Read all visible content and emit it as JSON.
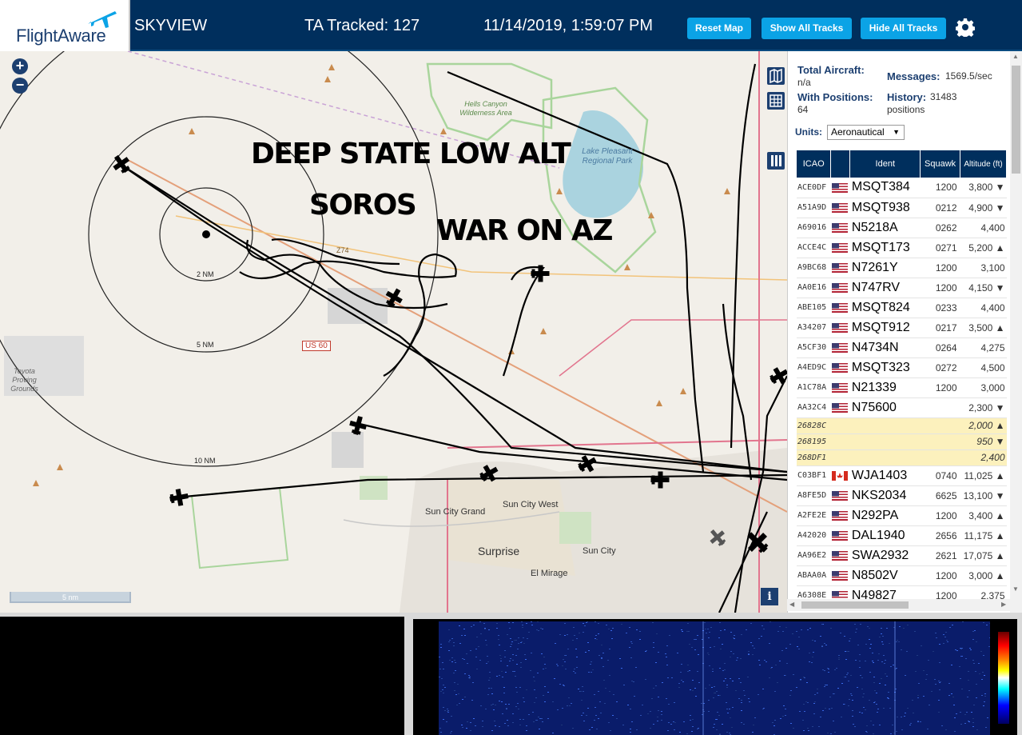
{
  "header": {
    "logo_text": "FlightAware",
    "app_name": "SKYVIEW",
    "tracked": "TA Tracked: 127",
    "datetime": "11/14/2019, 1:59:07 PM",
    "buttons": {
      "reset": "Reset Map",
      "show_all": "Show All Tracks",
      "hide_all": "Hide All Tracks"
    },
    "accent_color": "#0ba3e6",
    "bar_color": "#002f5d"
  },
  "map": {
    "zoom_in": "+",
    "zoom_out": "−",
    "overlay": [
      "DEEP STATE LOW ALT",
      "SOROS",
      "WAR ON AZ"
    ],
    "range_rings": [
      "2 NM",
      "5 NM",
      "10 NM"
    ],
    "places": [
      "Hells Canyon Wilderness Area",
      "Lake Pleasant Regional Park",
      "Toyota Proving Grounds",
      "Sun City Grand",
      "Sun City West",
      "Surprise",
      "Sun City",
      "El Mirage"
    ],
    "road_labels": [
      "US 60",
      "Z74"
    ],
    "scale": "5 nm",
    "info": "i"
  },
  "panel": {
    "total_aircraft_label": "Total Aircraft:",
    "total_aircraft_value": "n/a",
    "messages_label": "Messages:",
    "messages_value": "1569.5/sec",
    "with_positions_label": "With Positions:",
    "with_positions_value": "64",
    "history_label": "History:",
    "history_value": "31483",
    "history_unit": "positions",
    "units_label": "Units:",
    "units_value": "Aeronautical",
    "columns": {
      "icao": "ICAO",
      "ident": "Ident",
      "squawk": "Squawk",
      "altitude": "Altitude (ft)"
    },
    "rows": [
      {
        "icao": "ACE0DF",
        "flag": "US",
        "ident": "MSQT384",
        "squawk": "1200",
        "alt": "3,800 ▼"
      },
      {
        "icao": "A51A9D",
        "flag": "US",
        "ident": "MSQT938",
        "squawk": "0212",
        "alt": "4,900 ▼"
      },
      {
        "icao": "A69016",
        "flag": "US",
        "ident": "N5218A",
        "squawk": "0262",
        "alt": "4,400"
      },
      {
        "icao": "ACCE4C",
        "flag": "US",
        "ident": "MSQT173",
        "squawk": "0271",
        "alt": "5,200 ▲"
      },
      {
        "icao": "A9BC68",
        "flag": "US",
        "ident": "N7261Y",
        "squawk": "1200",
        "alt": "3,100"
      },
      {
        "icao": "AA0E16",
        "flag": "US",
        "ident": "N747RV",
        "squawk": "1200",
        "alt": "4,150 ▼"
      },
      {
        "icao": "ABE105",
        "flag": "US",
        "ident": "MSQT824",
        "squawk": "0233",
        "alt": "4,400"
      },
      {
        "icao": "A34207",
        "flag": "US",
        "ident": "MSQT912",
        "squawk": "0217",
        "alt": "3,500 ▲"
      },
      {
        "icao": "A5CF30",
        "flag": "US",
        "ident": "N4734N",
        "squawk": "0264",
        "alt": "4,275"
      },
      {
        "icao": "A4ED9C",
        "flag": "US",
        "ident": "MSQT323",
        "squawk": "0272",
        "alt": "4,500"
      },
      {
        "icao": "A1C78A",
        "flag": "US",
        "ident": "N21339",
        "squawk": "1200",
        "alt": "3,000"
      },
      {
        "icao": "AA32C4",
        "flag": "US",
        "ident": "N75600",
        "squawk": "",
        "alt": "2,300 ▼"
      },
      {
        "icao": "26828C",
        "flag": "",
        "ident": "",
        "squawk": "",
        "alt": "2,000 ▲",
        "mlat": true
      },
      {
        "icao": "268195",
        "flag": "",
        "ident": "",
        "squawk": "",
        "alt": "950 ▼",
        "mlat": true
      },
      {
        "icao": "268DF1",
        "flag": "",
        "ident": "",
        "squawk": "",
        "alt": "2,400",
        "mlat": true
      },
      {
        "icao": "C03BF1",
        "flag": "CA",
        "ident": "WJA1403",
        "squawk": "0740",
        "alt": "11,025 ▲"
      },
      {
        "icao": "A8FE5D",
        "flag": "US",
        "ident": "NKS2034",
        "squawk": "6625",
        "alt": "13,100 ▼"
      },
      {
        "icao": "A2FE2E",
        "flag": "US",
        "ident": "N292PA",
        "squawk": "1200",
        "alt": "3,400 ▲"
      },
      {
        "icao": "A42020",
        "flag": "US",
        "ident": "DAL1940",
        "squawk": "2656",
        "alt": "11,175 ▲"
      },
      {
        "icao": "AA96E2",
        "flag": "US",
        "ident": "SWA2932",
        "squawk": "2621",
        "alt": "17,075 ▲"
      },
      {
        "icao": "ABAA0A",
        "flag": "US",
        "ident": "N8502V",
        "squawk": "1200",
        "alt": "3,000 ▲"
      },
      {
        "icao": "A6308E",
        "flag": "US",
        "ident": "N49827",
        "squawk": "1200",
        "alt": "2,375"
      }
    ]
  }
}
